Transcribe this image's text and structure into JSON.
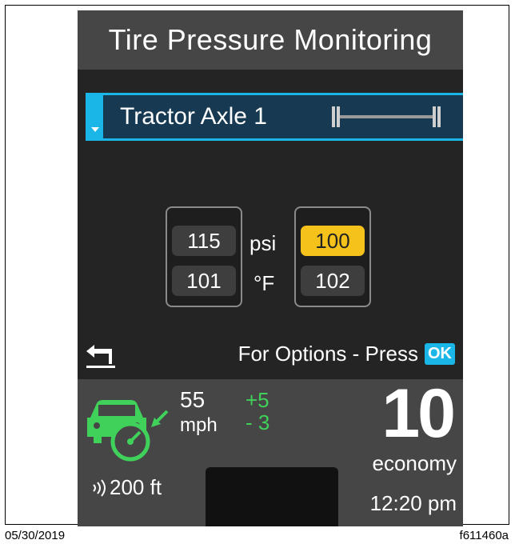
{
  "header": {
    "title": "Tire Pressure Monitoring"
  },
  "axle_selector": {
    "label": "Tractor Axle 1",
    "icon": "axle-icon"
  },
  "tires": {
    "left": {
      "pressure": "115",
      "temperature": "101"
    },
    "right": {
      "pressure": "100",
      "temperature": "102",
      "pressure_alert": true
    }
  },
  "units": {
    "pressure": "psi",
    "temperature": "°F"
  },
  "footer_hint": {
    "text": "For Options - Press",
    "ok_label": "OK"
  },
  "info_panel": {
    "speed": "55",
    "speed_unit": "mph",
    "delta_up": "+5",
    "delta_down": "- 3",
    "distance": "200 ft",
    "economy_value": "10",
    "economy_label": "economy",
    "time": "12:20 pm"
  },
  "caption": {
    "date": "05/30/2019",
    "figure_id": "f611460a"
  },
  "colors": {
    "accent": "#1ab6e8",
    "alert": "#f4c21b",
    "cruise_green": "#3fd15a",
    "screen_bg": "#242424",
    "panel_bg": "#464646"
  }
}
